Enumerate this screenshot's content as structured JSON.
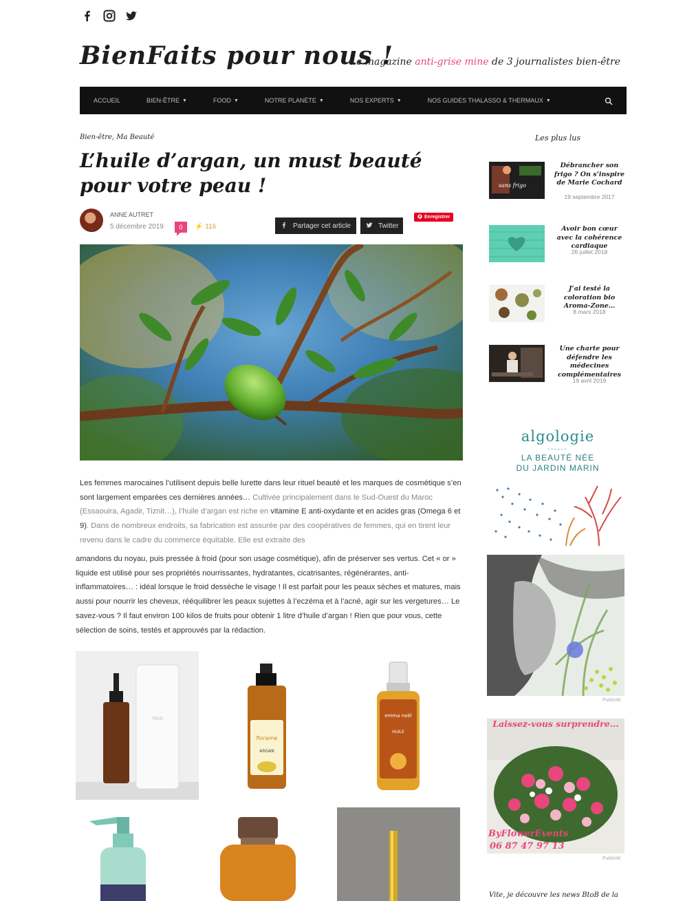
{
  "social": {
    "icons": [
      "facebook-icon",
      "instagram-icon",
      "twitter-icon"
    ]
  },
  "header": {
    "brand": "BienFaits pour nous !",
    "tagline_pre": "Le magazine ",
    "tagline_accent": "anti-grise mine",
    "tagline_post": " de 3 journalistes bien-être"
  },
  "nav": {
    "items": [
      {
        "label": "ACCUEIL",
        "has_caret": false
      },
      {
        "label": "BIEN-ÊTRE",
        "has_caret": true
      },
      {
        "label": "FOOD",
        "has_caret": true
      },
      {
        "label": "NOTRE PLANÈTE",
        "has_caret": true
      },
      {
        "label": "NOS EXPERTS",
        "has_caret": true
      },
      {
        "label": "NOS GUIDES THALASSO & THERMAUX",
        "has_caret": true
      }
    ]
  },
  "article": {
    "breadcrumb": "Bien-être, Ma Beauté",
    "title": "L’huile d’argan, un must beauté pour votre peau !",
    "author": "ANNE AUTRET",
    "date": "5 décembre 2019",
    "comments": "0",
    "views": "116",
    "share_facebook": "Partager cet article",
    "share_twitter": "Twitter",
    "save_label": "Enregistrer",
    "para1_dark": "Les femmes marocaines l’utilisent depuis belle lurette dans leur rituel beauté et les marques de cosmétique s’en sont largement emparées ces dernières années…",
    "para1_light1": " Cultivée principalement dans le Sud-Ouest du Maroc (Essaouira, Agadir, Tiznit…), l’huile d’argan est riche en ",
    "para1_dark2": "vitamine E anti-oxydante et en acides gras (Omega 6 et 9)",
    "para1_light2": ". Dans de nombreux endroits, sa fabrication est assurée par des coopératives de femmes, qui en tirent leur revenu dans le cadre du commerce équitable. Elle est extraite des",
    "para2_text": "amandons du noyau, puis pressée à froid (pour son usage cosmétique), afin de préserver ses vertus. Cet « or » liquide est utilisé pour ses propriétés nourrissantes, hydratantes, cicatrisantes, régénérantes, anti-inflammatoires… : idéal lorsque le froid dessèche le visage ! Il est parfait pour les peaux sèches et matures, mais aussi pour nourrir les cheveux, rééquilibrer les peaux sujettes à l’eczéma et à l’acné, agir sur les vergetures… Le savez-vous ? Il faut environ 100 kilos de fruits pour obtenir 1 litre d’huile d’argan ! Rien que pour vous, cette sélection de soins, testés et approuvés par la rédaction."
  },
  "products": {
    "p1_label": "TRUE",
    "p2_label": "florame",
    "p2_sub": "ARGAN",
    "p3_label": "emma noël",
    "p3_sub": "HUILE"
  },
  "sidebar": {
    "title": "Les plus lus",
    "popular": [
      {
        "title": "Débrancher son frigo ? On s’inspire de Marie Cochard",
        "date": "19 septembre 2017",
        "thumb_text": "sans frigo"
      },
      {
        "title": "Avoir bon cœur avec la cohérence cardiaque",
        "date": "26 juillet 2018"
      },
      {
        "title": "J’ai testé la coloration bio Aroma-Zone…",
        "date": "8 mars 2018"
      },
      {
        "title": "Une charte pour défendre les médecines complémentaires",
        "date": "19 avril 2019"
      }
    ],
    "ad1_brand": "algologie",
    "ad1_brand_sub": "FRANCE",
    "ad1_line1": "LA BEAUTÉ NÉE",
    "ad1_line2": "DU JARDIN MARIN",
    "pub1": "Publicité",
    "ad3_headline": "Laissez-vous surprendre...",
    "ad3_brand": "ByFlowerEvents",
    "ad3_phone": "06 87 47 97 13",
    "pub2": "Publicité",
    "footer_teaser": "Vite, je découvre les news BtoB de la"
  },
  "colors": {
    "accent_pink": "#e8467c",
    "nav_bg": "#111111",
    "views_orange": "#e59c2e",
    "pinterest_red": "#e60023"
  }
}
